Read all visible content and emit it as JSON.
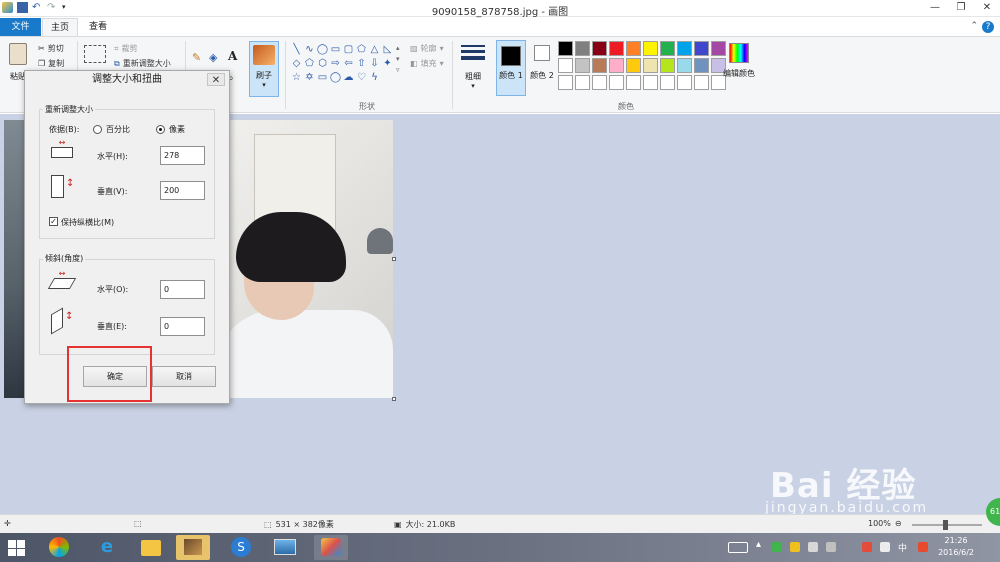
{
  "window": {
    "title": "9090158_878758.jpg - 画图"
  },
  "tabs": {
    "file": "文件",
    "home": "主页",
    "view": "查看"
  },
  "ribbon": {
    "clipboard": {
      "paste": "粘贴",
      "cut": "剪切",
      "copy": "复制"
    },
    "image": {
      "crop": "裁剪",
      "resize": "重新调整大小"
    },
    "brush": "刷子",
    "shapes": {
      "outline": "轮廓",
      "fill": "填充",
      "label": "形状"
    },
    "size": "粗细",
    "colors": {
      "color1": "颜色 1",
      "color2": "颜色 2",
      "edit": "编辑颜色",
      "label": "颜色"
    },
    "palette": [
      "#000000",
      "#7f7f7f",
      "#880015",
      "#ed1c24",
      "#ff7f27",
      "#fff200",
      "#22b14c",
      "#00a2e8",
      "#3f48cc",
      "#a349a4",
      "#ffffff",
      "#c3c3c3",
      "#b97a57",
      "#ffaec9",
      "#ffc90e",
      "#efe4b0",
      "#b5e61d",
      "#99d9ea",
      "#7092be",
      "#c8bfe7",
      "#ffffff",
      "#ffffff",
      "#ffffff",
      "#ffffff",
      "#ffffff",
      "#ffffff",
      "#ffffff",
      "#ffffff",
      "#ffffff",
      "#ffffff"
    ]
  },
  "dialog": {
    "title": "调整大小和扭曲",
    "resize": {
      "label": "重新调整大小",
      "by": "依据(B):",
      "percent": "百分比",
      "pixels": "像素",
      "horizontal_label": "水平(H):",
      "horizontal_value": "278",
      "vertical_label": "垂直(V):",
      "vertical_value": "200",
      "keep_ratio": "保持纵横比(M)"
    },
    "skew": {
      "label": "倾斜(角度)",
      "horizontal_label": "水平(O):",
      "horizontal_value": "0",
      "vertical_label": "垂直(E):",
      "vertical_value": "0"
    },
    "ok": "确定",
    "cancel": "取消"
  },
  "status": {
    "dimensions": "531 × 382像素",
    "size": "大小: 21.0KB",
    "zoom": "100%"
  },
  "taskbar": {
    "time": "21:26",
    "date": "2016/6/2",
    "ime": "中"
  },
  "watermark": {
    "main": "Bai 经验",
    "sub": "jingyan.baidu.com",
    "badge": "61"
  }
}
